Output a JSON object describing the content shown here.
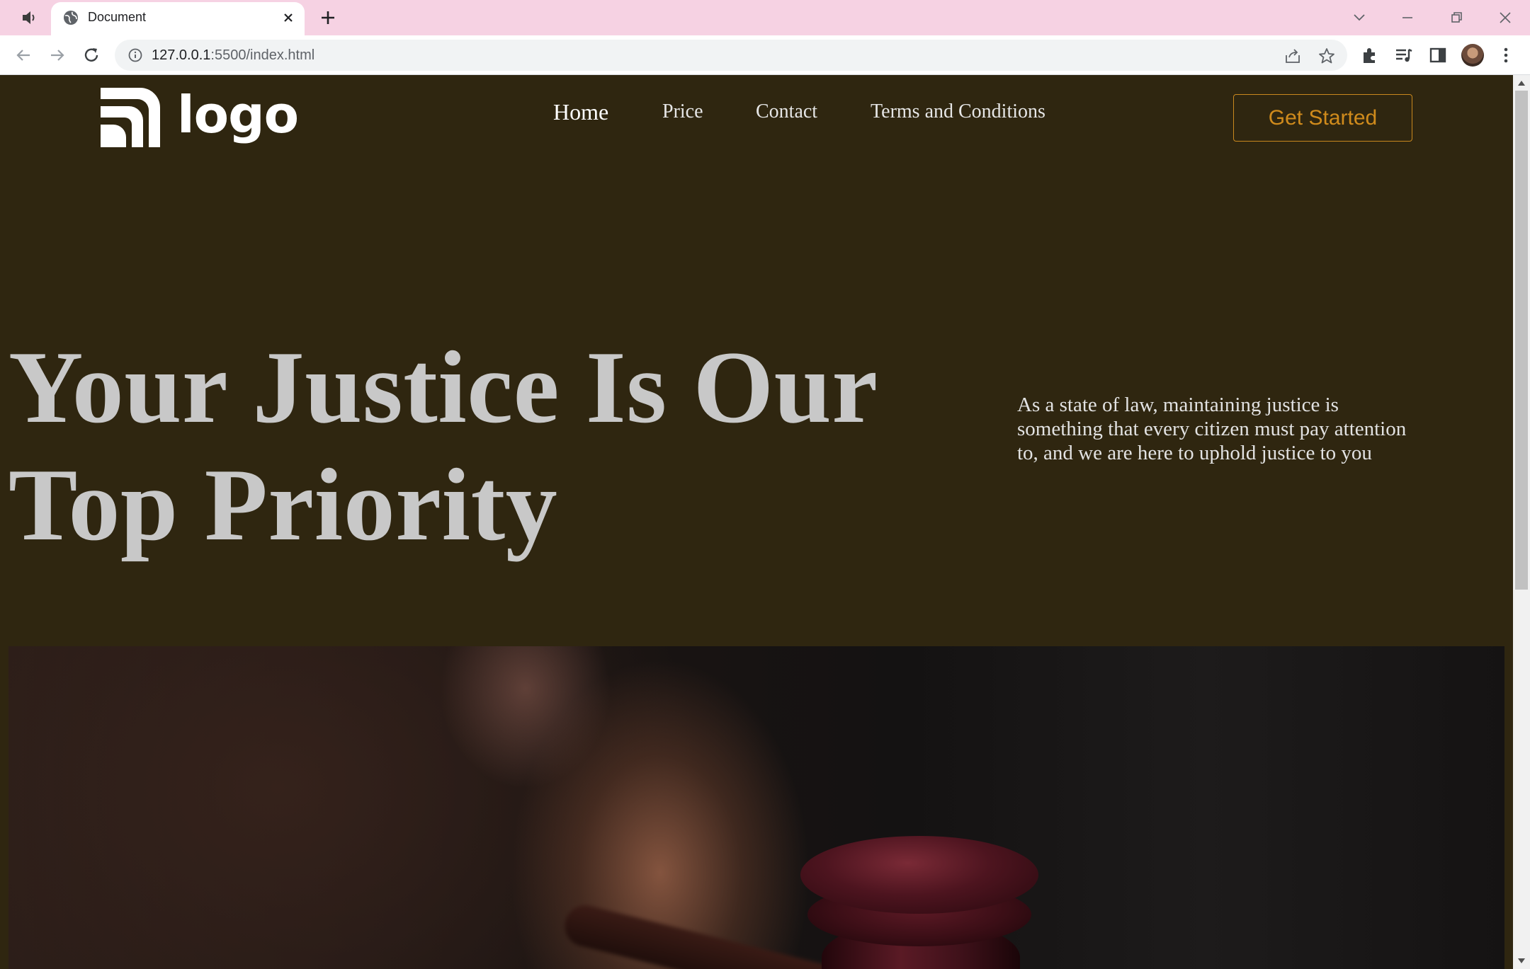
{
  "browser": {
    "tab_title": "Document",
    "url_host": "127.0.0.1",
    "url_rest": ":5500/index.html"
  },
  "site": {
    "logo_text": "logo",
    "nav": [
      {
        "label": "Home",
        "active": true
      },
      {
        "label": "Price",
        "active": false
      },
      {
        "label": "Contact",
        "active": false
      },
      {
        "label": "Terms and Conditions",
        "active": false
      }
    ],
    "cta_label": "Get Started",
    "hero_line1": "Your Justice Is Our",
    "hero_line2": "Top Priority",
    "hero_description": "As a state of law, maintaining justice is something that every citizen must pay attention to, and we are here to uphold justice to you"
  },
  "colors": {
    "page_bg": "#2f2610",
    "accent": "#d08b1c",
    "tabstrip": "#f6d2e3",
    "hero_text": "#c8c8c8"
  },
  "icons": [
    "speaker-icon",
    "globe-icon",
    "close-icon",
    "plus-icon",
    "chevron-down-icon",
    "minimize-icon",
    "restore-icon",
    "back-icon",
    "forward-icon",
    "reload-icon",
    "info-icon",
    "share-icon",
    "star-icon",
    "extensions-icon",
    "media-icon",
    "side-panel-icon",
    "menu-icon"
  ]
}
